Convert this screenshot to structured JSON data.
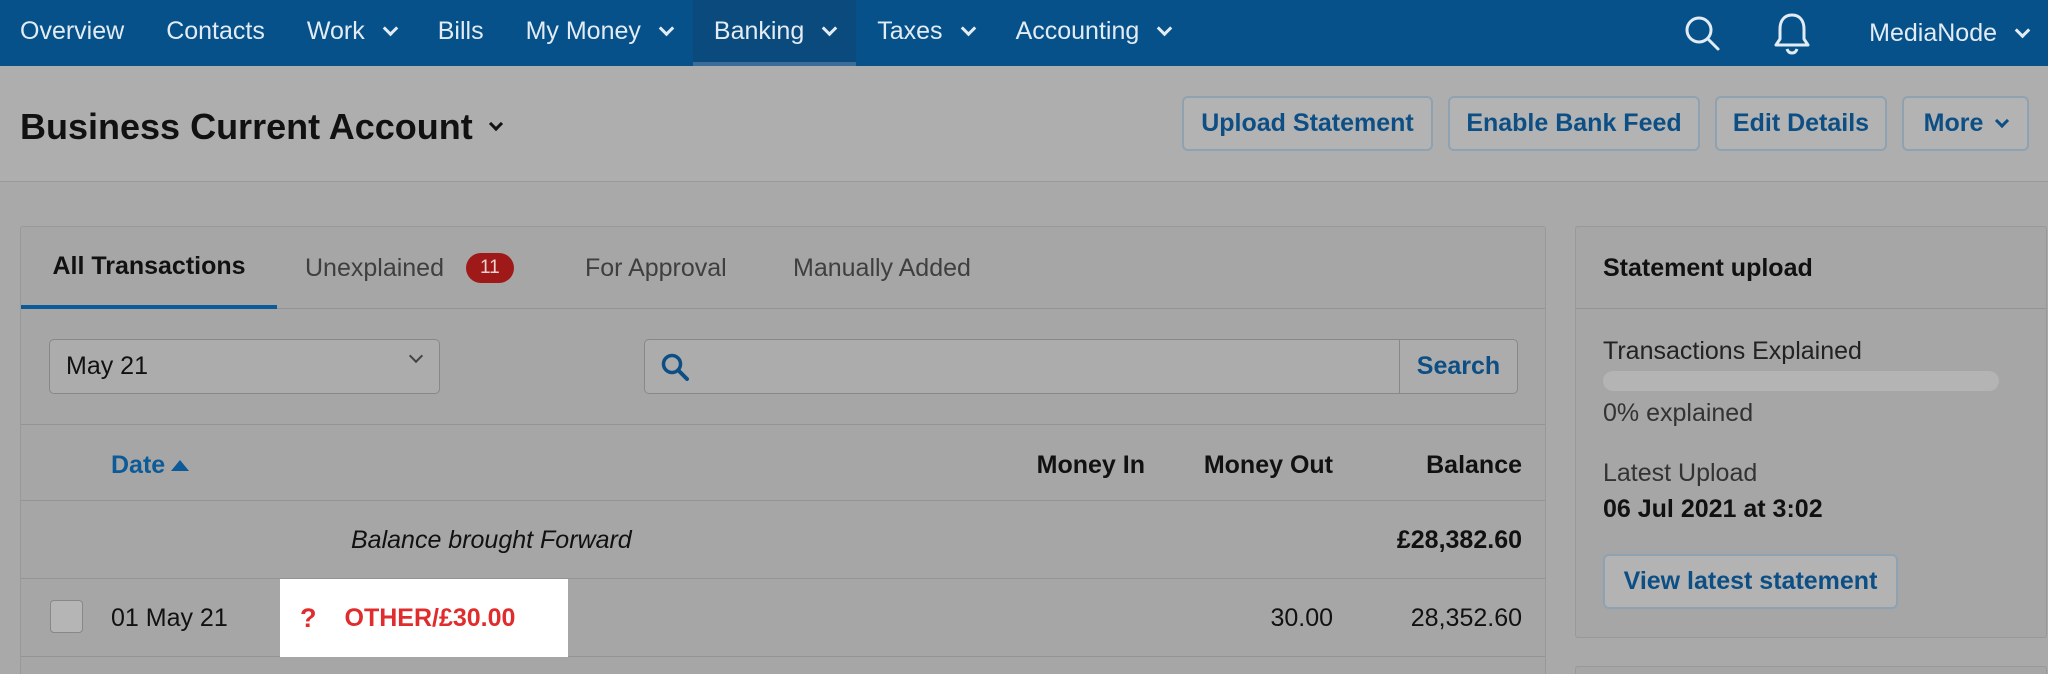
{
  "nav": {
    "items": [
      {
        "label": "Overview",
        "dropdown": false
      },
      {
        "label": "Contacts",
        "dropdown": false
      },
      {
        "label": "Work",
        "dropdown": true
      },
      {
        "label": "Bills",
        "dropdown": false
      },
      {
        "label": "My Money",
        "dropdown": true
      },
      {
        "label": "Banking",
        "dropdown": true,
        "active": true
      },
      {
        "label": "Taxes",
        "dropdown": true
      },
      {
        "label": "Accounting",
        "dropdown": true
      }
    ],
    "search_icon": "search-icon",
    "bell_icon": "bell-icon",
    "user_label": "MediaNode"
  },
  "header": {
    "title": "Business Current Account",
    "buttons": {
      "upload": "Upload Statement",
      "bank_feed": "Enable Bank Feed",
      "edit": "Edit Details",
      "more": "More"
    }
  },
  "tabs": {
    "all": "All Transactions",
    "unexplained": "Unexplained",
    "unexplained_count": "11",
    "approval": "For Approval",
    "manual": "Manually Added"
  },
  "filters": {
    "month": "May 21",
    "search_value": "",
    "search_label": "Search"
  },
  "table": {
    "headers": {
      "date": "Date",
      "money_in": "Money In",
      "money_out": "Money Out",
      "balance": "Balance"
    },
    "brought_forward": {
      "label": "Balance brought Forward",
      "balance": "£28,382.60"
    },
    "rows": [
      {
        "date": "01 May 21",
        "status_icon": "?",
        "description": "OTHER/£30.00",
        "money_in": "",
        "money_out": "30.00",
        "balance": "28,352.60"
      }
    ]
  },
  "statement_upload": {
    "title": "Statement upload",
    "explained_label": "Transactions Explained",
    "explained_fraction": 0,
    "explained_text": "0% explained",
    "latest_label": "Latest Upload",
    "latest_value": "06 Jul 2021 at 3:02",
    "view_button": "View latest statement"
  },
  "colors": {
    "nav_bg": "#06518a",
    "link_blue": "#0d4f84",
    "badge_red": "#a01919",
    "unexplained_red": "#e02c2c"
  }
}
